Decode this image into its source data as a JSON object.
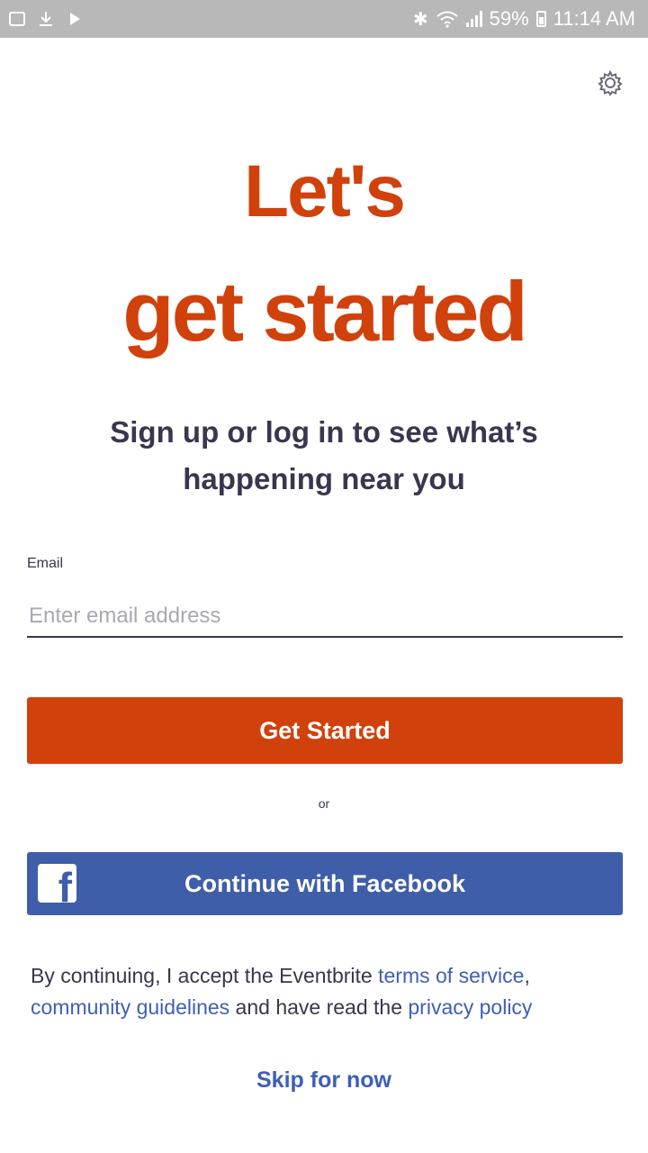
{
  "status_bar": {
    "battery": "59%",
    "time": "11:14 AM"
  },
  "settings": {
    "icon": "gear-icon"
  },
  "hero": {
    "line1": "Let's",
    "line2": "get started",
    "subtitle": "Sign up or log in to see what’s happening near you"
  },
  "email": {
    "label": "Email",
    "placeholder": "Enter email address",
    "value": ""
  },
  "buttons": {
    "get_started": "Get Started",
    "or": "or",
    "facebook": "Continue with Facebook"
  },
  "legal": {
    "prefix": "By continuing, I accept the Eventbrite ",
    "terms": "terms of service",
    "sep": ", ",
    "guidelines": "community guidelines",
    "middle": " and have read the ",
    "privacy": "privacy policy"
  },
  "skip": "Skip for now",
  "colors": {
    "brand": "#d1410c",
    "facebook": "#3f5ea9",
    "link": "#3e5fb6",
    "text": "#39364f"
  }
}
